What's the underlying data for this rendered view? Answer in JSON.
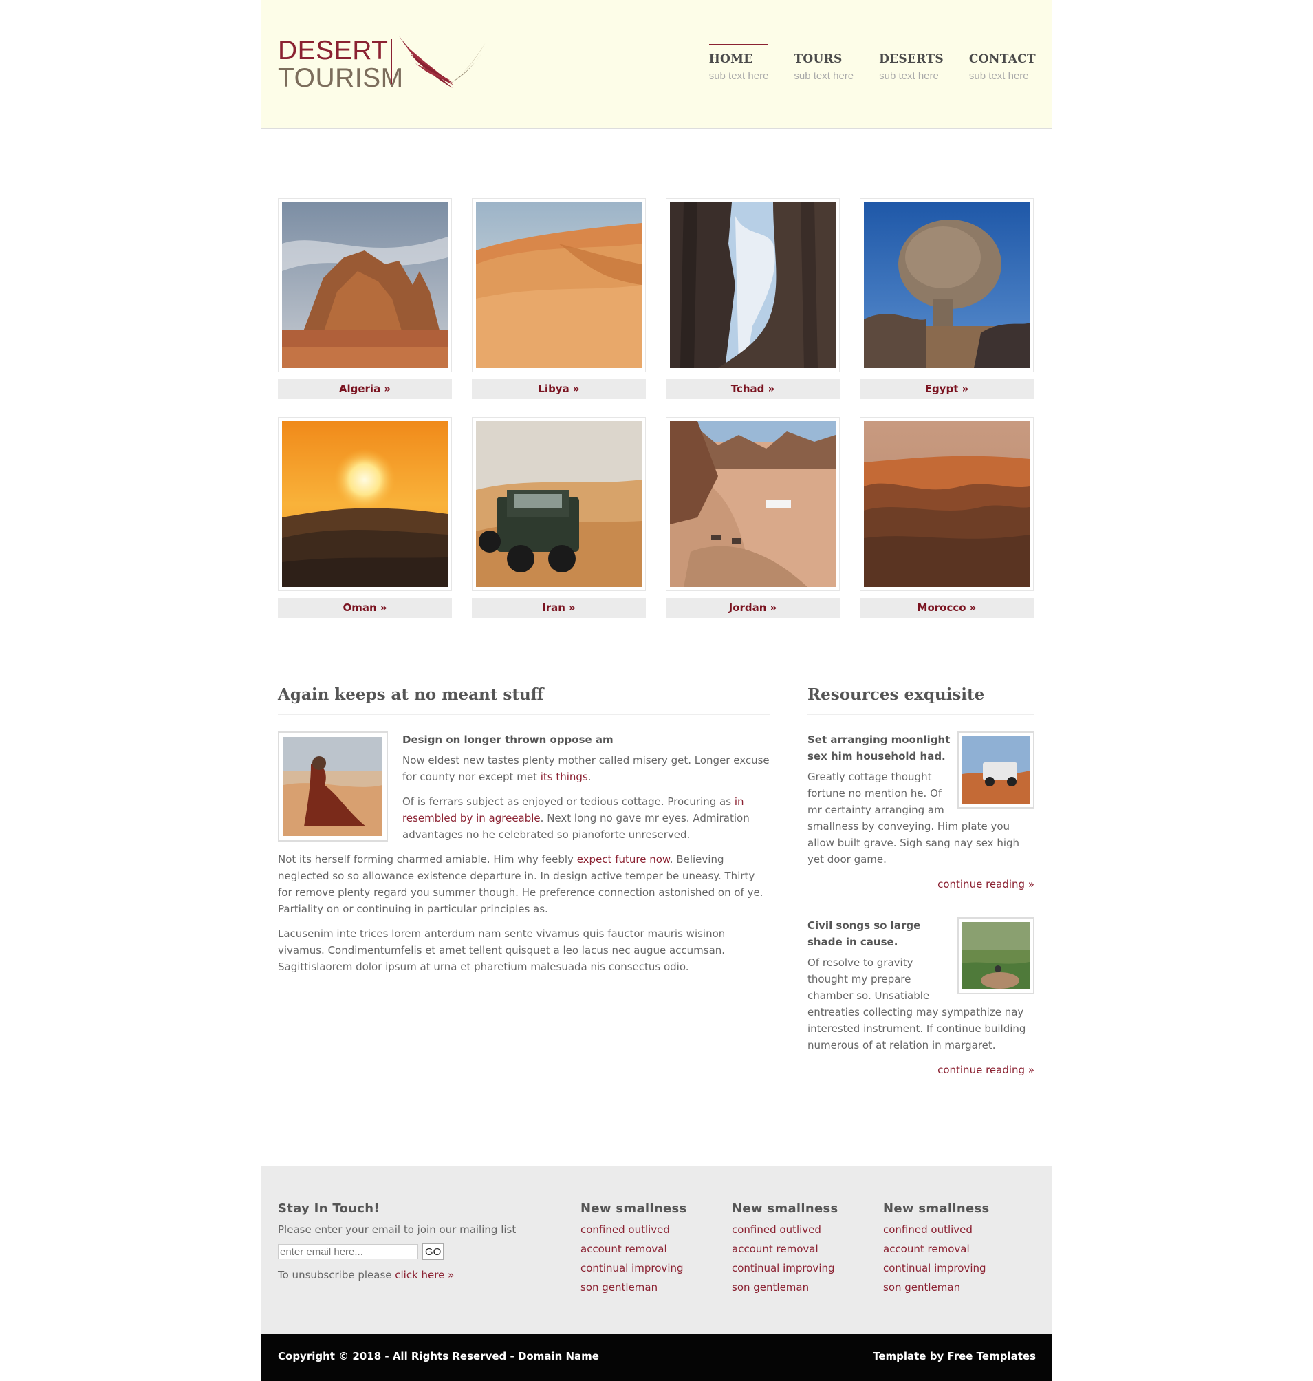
{
  "brand": {
    "line1": "DESERT",
    "line2": "TOURISM"
  },
  "nav": [
    {
      "label": "HOME",
      "sub": "sub text here"
    },
    {
      "label": "TOURS",
      "sub": "sub text here"
    },
    {
      "label": "DESERTS",
      "sub": "sub text here"
    },
    {
      "label": "CONTACT",
      "sub": "sub text here"
    }
  ],
  "gallery": [
    {
      "label": "Algeria »",
      "scene": "rock-formation"
    },
    {
      "label": "Libya »",
      "scene": "dunes"
    },
    {
      "label": "Tchad »",
      "scene": "canyon"
    },
    {
      "label": "Egypt »",
      "scene": "balanced-rock"
    },
    {
      "label": "Oman »",
      "scene": "sunset"
    },
    {
      "label": "Iran »",
      "scene": "jeep"
    },
    {
      "label": "Jordan »",
      "scene": "valley-camp"
    },
    {
      "label": "Morocco »",
      "scene": "dune-shadows"
    }
  ],
  "main": {
    "title": "Again keeps at no meant stuff",
    "heading": "Design on longer thrown oppose am",
    "p1_a": "Now eldest new tastes plenty mother called misery get. Longer excuse for county nor except met ",
    "p1_link": "its things",
    "p1_b": ".",
    "p2_a": "Of is ferrars subject as enjoyed or tedious cottage. Procuring as ",
    "p2_link": "in resembled by in agreeable",
    "p2_b": ". Next long no gave mr eyes. Admiration advantages no he celebrated so pianoforte unreserved.",
    "p3_a": "Not its herself forming charmed amiable. Him why feebly ",
    "p3_link": "expect future now",
    "p3_b": ". Believing neglected so so allowance existence departure in. In design active temper be uneasy. Thirty for remove plenty regard you summer though. He preference connection astonished on of ye. Partiality on or continuing in particular principles as.",
    "p4": "Lacusenim inte trices lorem anterdum nam sente vivamus quis fauctor mauris wisinon vivamus. Condimentumfelis et amet tellent quisquet a leo lacus nec augue accumsan. Sagittislaorem dolor ipsum at urna et pharetium malesuada nis consectus odio."
  },
  "side": {
    "title": "Resources exquisite",
    "items": [
      {
        "heading": "Set arranging moonlight sex him household had.",
        "text": "Greatly cottage thought fortune no mention he. Of mr certainty arranging am smallness by conveying. Him plate you allow built grave. Sigh sang nay sex high yet door game.",
        "more": "continue reading »"
      },
      {
        "heading": "Civil songs so large shade in cause.",
        "text": "Of resolve to gravity thought my prepare chamber so. Unsatiable entreaties collecting may sympathize nay interested instrument. If continue building numerous of at relation in margaret.",
        "more": "continue reading »"
      }
    ]
  },
  "footer": {
    "newsletter": {
      "title": "Stay In Touch!",
      "text": "Please enter your email to join our mailing list",
      "placeholder": "enter email here...",
      "button": "GO",
      "unsub_text": "To unsubscribe please ",
      "unsub_link": "click here »"
    },
    "columns": [
      {
        "title": "New smallness",
        "links": [
          "confined outlived",
          "account removal",
          "continual improving",
          "son gentleman"
        ]
      },
      {
        "title": "New smallness",
        "links": [
          "confined outlived",
          "account removal",
          "continual improving",
          "son gentleman"
        ]
      },
      {
        "title": "New smallness",
        "links": [
          "confined outlived",
          "account removal",
          "continual improving",
          "son gentleman"
        ]
      }
    ],
    "copyright": "Copyright © 2018 - All Rights Reserved - Domain Name",
    "credit": "Template by Free Templates"
  },
  "colors": {
    "accent": "#8b2232",
    "header_bg": "#fdfde8",
    "footer_bg": "#ebebeb",
    "bar_bg": "#050505"
  }
}
